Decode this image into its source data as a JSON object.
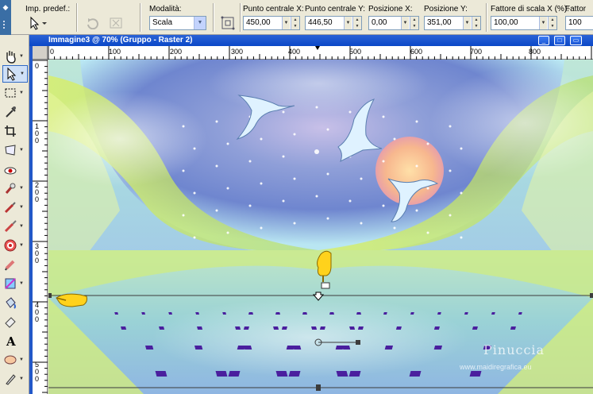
{
  "toolbar": {
    "preset_label": "Imp. predef.:",
    "mode_label": "Modalità:",
    "mode_value": "Scala",
    "center_x_label": "Punto centrale X:",
    "center_x_value": "450,00",
    "center_y_label": "Punto centrale Y:",
    "center_y_value": "446,50",
    "pos_x_label": "Posizione X:",
    "pos_x_value": "0,00",
    "pos_y_label": "Posizione Y:",
    "pos_y_value": "351,00",
    "scale_x_label": "Fattore di scala X (%):",
    "scale_x_value": "100,00",
    "scale_y_label": "Fattor",
    "scale_y_value": "100"
  },
  "window": {
    "title": "Immagine3 @ 70% (Gruppo - Raster 2)"
  },
  "ruler": {
    "h_labels": [
      "0",
      "100",
      "200",
      "300",
      "400",
      "500",
      "600",
      "700",
      "800"
    ],
    "v_labels": [
      "0",
      "1 0 0",
      "2 0 0",
      "3 0 0",
      "4 0 0",
      "5 0 0"
    ]
  },
  "tools": [
    "pan",
    "pick",
    "selection",
    "dropper",
    "crop",
    "move-object",
    "red-eye",
    "clone",
    "scratch",
    "dodge",
    "eraser-pen",
    "color-replacer",
    "retouch",
    "object-selector",
    "eraser",
    "text",
    "preset-shape",
    "pen"
  ],
  "watermark": {
    "name": "Pinuccia",
    "url": "www.maidiregrafica.eu"
  },
  "colors": {
    "title_bar": "#0b48c8",
    "accent": "#316ac5",
    "toolbar_bg": "#ece9d8"
  }
}
